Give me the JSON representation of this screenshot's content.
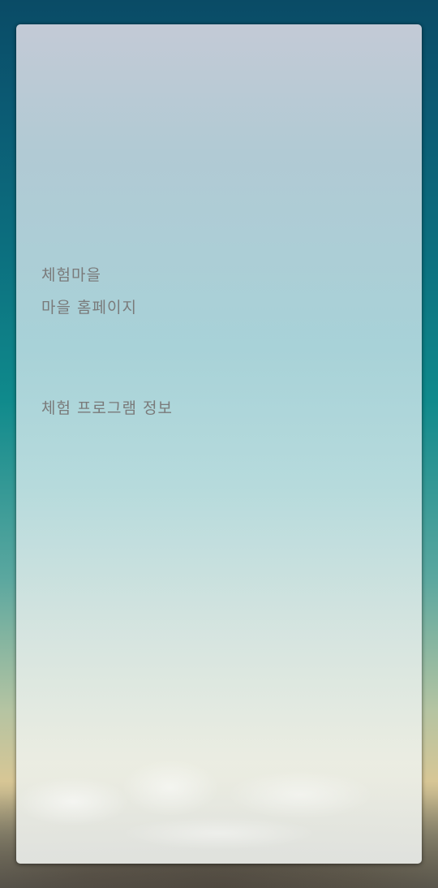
{
  "menu": {
    "items": [
      {
        "label": "체험마을"
      },
      {
        "label": "마을 홈페이지"
      },
      {
        "label": "체험 프로그램 정보"
      }
    ]
  },
  "colors": {
    "link_text": "#7a7a7a",
    "card_top": "#c7ccd8",
    "card_bottom": "#eceee4",
    "background_top": "#0a4b66"
  }
}
